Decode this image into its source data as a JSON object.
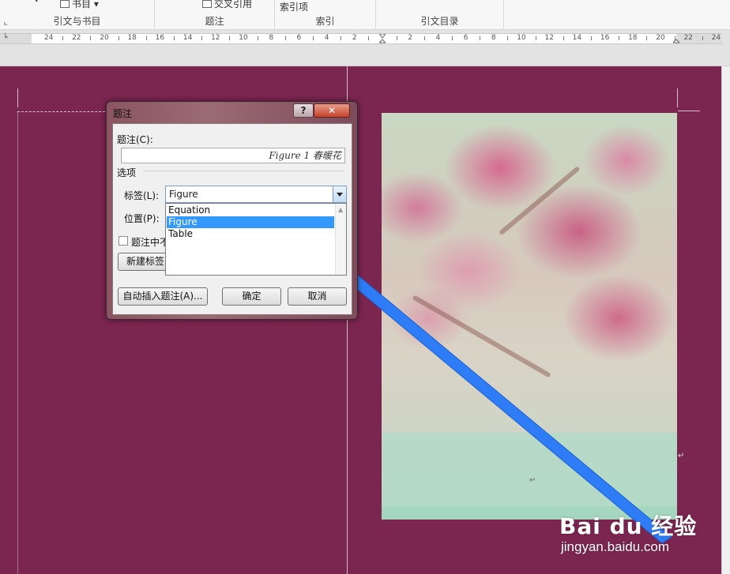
{
  "ribbon": {
    "groups": [
      {
        "label": "引文与书目",
        "cmd": "书目"
      },
      {
        "label": "题注",
        "cmd": "交叉引用"
      },
      {
        "label": "索引",
        "cmd": "索引项"
      },
      {
        "label": "引文目录",
        "cmd": ""
      }
    ]
  },
  "ruler": {
    "left_numbers": [
      "24",
      "22",
      "20",
      "18",
      "16",
      "14",
      "12",
      "10",
      "8",
      "6",
      "4",
      "2"
    ],
    "right_numbers": [
      "2",
      "4",
      "6",
      "8",
      "10",
      "12",
      "14",
      "16",
      "18",
      "20",
      "22",
      "24"
    ]
  },
  "dialog": {
    "title": "题注",
    "help": "?",
    "close": "✕",
    "caption_label": "题注(C):",
    "caption_value": "Figure 1 春暖花",
    "options_label": "选项",
    "label_label": "标签(L):",
    "label_value": "Figure",
    "position_label": "位置(P):",
    "options": [
      "Equation",
      "Figure",
      "Table"
    ],
    "selected_option": "Figure",
    "exclude_label_checkbox": "题注中不",
    "new_label_button": "新建标签",
    "autocaption_button": "自动插入题注(A)...",
    "ok_button": "确定",
    "cancel_button": "取消"
  },
  "watermark": {
    "logo": "Bai du 经验",
    "url": "jingyan.baidu.com"
  },
  "colors": {
    "page_background": "#7b2650",
    "selection": "#3399ff",
    "arrow": "#2f7df6"
  }
}
